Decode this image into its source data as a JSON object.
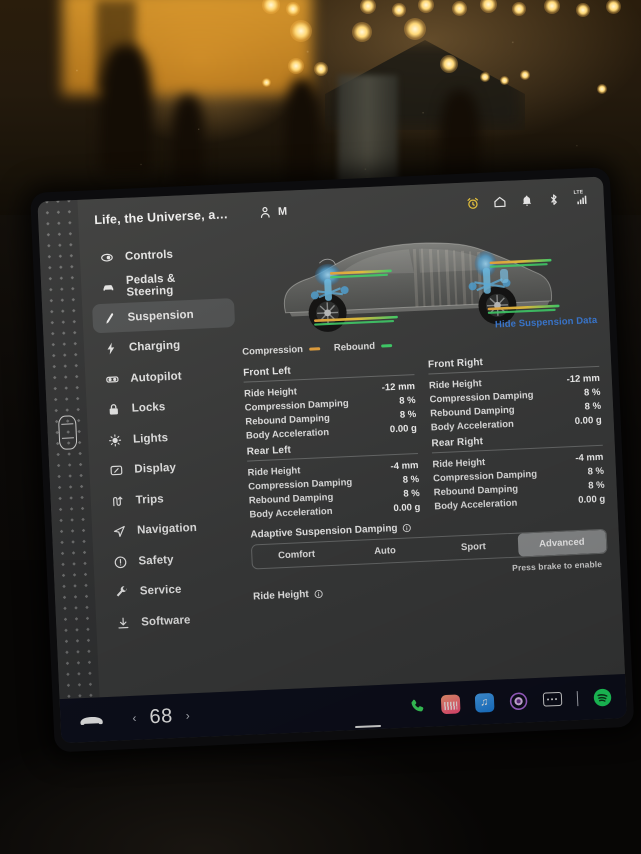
{
  "header": {
    "vehicle_name": "Life, the Universe, a…",
    "profile_icon": "person-icon",
    "profile_initial": "M",
    "status_icons": [
      "alarm-clock-icon",
      "home-icon",
      "bell-icon",
      "bluetooth-icon",
      "lte-signal-icon"
    ],
    "lte_label": "LTE"
  },
  "sidebar": {
    "items": [
      {
        "label": "Controls",
        "icon": "controls-icon"
      },
      {
        "label": "Pedals & Steering",
        "icon": "pedals-steering-icon"
      },
      {
        "label": "Suspension",
        "icon": "suspension-icon",
        "selected": true
      },
      {
        "label": "Charging",
        "icon": "charging-bolt-icon"
      },
      {
        "label": "Autopilot",
        "icon": "autopilot-icon"
      },
      {
        "label": "Locks",
        "icon": "lock-icon"
      },
      {
        "label": "Lights",
        "icon": "lights-icon"
      },
      {
        "label": "Display",
        "icon": "display-icon"
      },
      {
        "label": "Trips",
        "icon": "trips-icon"
      },
      {
        "label": "Navigation",
        "icon": "navigation-arrow-icon"
      },
      {
        "label": "Safety",
        "icon": "safety-icon"
      },
      {
        "label": "Service",
        "icon": "wrench-icon"
      },
      {
        "label": "Software",
        "icon": "software-download-icon"
      }
    ]
  },
  "main": {
    "vehicle_diagram": "suspension-cutaway-diagram",
    "legend": [
      {
        "label": "Compression",
        "color": "#e8a33d"
      },
      {
        "label": "Rebound",
        "color": "#3fd36a"
      }
    ],
    "hide_data_link": "Hide Suspension Data",
    "hide_data_link_color": "#3a7bd8",
    "metric_labels": [
      "Ride Height",
      "Compression Damping",
      "Rebound Damping",
      "Body Acceleration"
    ],
    "corners": [
      {
        "title": "Front Left",
        "values": [
          "-12 mm",
          "8 %",
          "8 %",
          "0.00 g"
        ]
      },
      {
        "title": "Front Right",
        "values": [
          "-12 mm",
          "8 %",
          "8 %",
          "0.00 g"
        ]
      },
      {
        "title": "Rear Left",
        "values": [
          "-4 mm",
          "8 %",
          "8 %",
          "0.00 g"
        ]
      },
      {
        "title": "Rear Right",
        "values": [
          "-4 mm",
          "8 %",
          "8 %",
          "0.00 g"
        ]
      }
    ],
    "adaptive_damping": {
      "title": "Adaptive Suspension Damping",
      "info_icon": "info-icon",
      "options": [
        "Comfort",
        "Auto",
        "Sport",
        "Advanced"
      ],
      "selected": "Advanced",
      "hint": "Press brake to enable"
    },
    "ride_height": {
      "title": "Ride Height",
      "info_icon": "info-icon"
    }
  },
  "taskbar": {
    "car_icon": "car-front-icon",
    "prev_icon": "chevron-left-icon",
    "temperature": "68",
    "next_icon": "chevron-right-icon",
    "apps": [
      {
        "name": "phone-app-icon"
      },
      {
        "name": "media-app-icon"
      },
      {
        "name": "music-app-icon"
      },
      {
        "name": "theater-app-icon"
      },
      {
        "name": "more-apps-icon"
      },
      {
        "name": "divider"
      },
      {
        "name": "spotify-app-icon"
      }
    ]
  }
}
